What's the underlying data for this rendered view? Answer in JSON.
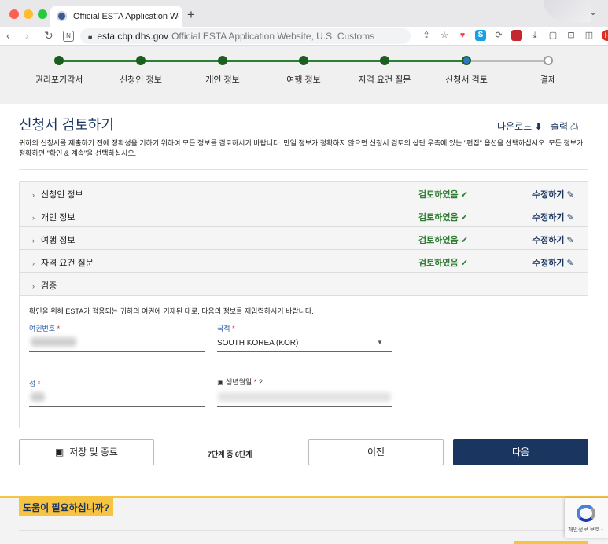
{
  "browser": {
    "tab_title": "Official ESTA Application Website",
    "new_tab": "+",
    "url_domain": "esta.cbp.dhs.gov",
    "url_title": "Official ESTA Application Website, U.S. Customs",
    "avatar": "H"
  },
  "progress": {
    "steps": [
      "권리포기각서",
      "신청인 정보",
      "개인 정보",
      "여행 정보",
      "자격 요건 질문",
      "신청서 검토",
      "결제"
    ],
    "completed": 5,
    "current_index": 5
  },
  "main": {
    "title": "신청서 검토하기",
    "download_label": "다운로드",
    "print_label": "출력",
    "intro": "귀하의 신청서를 제출하기 전에 정확성을 기하기 위하여 모든 정보를 검토하시기 바랍니다. 만일 정보가 정확하지 않으면 신청서 검토의 상단 우측에 있는 \"편집\" 옵션을 선택하십시오. 모든 정보가 정확하면 \"확인 & 계속\"을 선택하십시오."
  },
  "sections": [
    {
      "label": "신청인 정보",
      "status": "검토하였음",
      "edit": "수정하기"
    },
    {
      "label": "개인 정보",
      "status": "검토하였음",
      "edit": "수정하기"
    },
    {
      "label": "여행 정보",
      "status": "검토하였음",
      "edit": "수정하기"
    },
    {
      "label": "자격 요건 질문",
      "status": "검토하였음",
      "edit": "수정하기"
    },
    {
      "label": "검증"
    }
  ],
  "verification": {
    "instruction": "확인을 위해 ESTA가 적용되는 귀하의 여권에 기재된 대로, 다음의 정보를 재입력하시기 바랍니다.",
    "passport_label": "여권번호",
    "nationality_label": "국적",
    "nationality_value": "SOUTH KOREA (KOR)",
    "surname_label": "성",
    "dob_label": "생년월일",
    "required_mark": "*"
  },
  "actions": {
    "save_label": "저장 및 종료",
    "step_text": "7단계 중 6단계",
    "prev_label": "이전",
    "next_label": "다음"
  },
  "help": {
    "label": "도움이 필요하십니까?"
  },
  "recaptcha": {
    "text": "개인정보 보호 -"
  },
  "colors": {
    "navy": "#1a3560",
    "green": "#2e7d32",
    "help_yellow": "#f6c342"
  }
}
